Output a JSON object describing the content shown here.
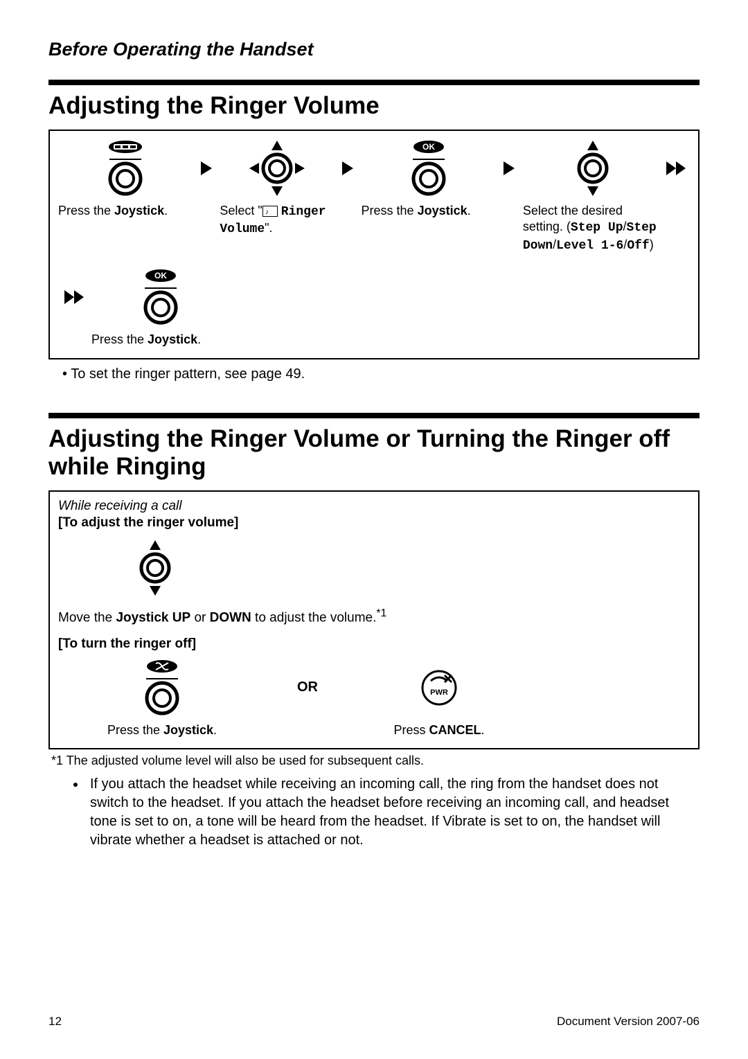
{
  "header": "Before Operating the Handset",
  "title1": "Adjusting the Ringer Volume",
  "steps1": {
    "s1": "Press the <b>Joystick</b>.",
    "s2": "Select \"<svg style='display:inline;vertical-align:-3px' width='22' height='16'><rect x='0.5' y='0.5' width='21' height='15' fill='none' stroke='#000'/><text x='4' y='12' font-size='10'>♪</text></svg> <span class='mono'>Ringer Volume</span>\".",
    "s3": "Press the <b>Joystick</b>.",
    "s4": "Select the desired setting. (<span class='mono'>Step Up</span>/<span class='mono'>Step Down</span>/<span class='mono'>Level 1-6</span>/<span class='mono'>Off</span>)",
    "s5": "Press the <b>Joystick</b>."
  },
  "bullet1": "To set the ringer pattern, see page 49.",
  "title2": "Adjusting the Ringer Volume or Turning the Ringer off while Ringing",
  "context2": "While receiving a call",
  "sub2a": "[To adjust the ringer volume]",
  "cap2a": "Move the <b>Joystick UP</b> or <b>DOWN</b> to adjust the volume.<sup>*1</sup>",
  "sub2b": "[To turn the ringer off]",
  "cap2b1": "Press the <b>Joystick</b>.",
  "or": "OR",
  "cap2b2": "Press <b>CANCEL</b>.",
  "footnote": "*1   The adjusted volume level will also be used for subsequent calls.",
  "bulletBody": "If you attach the headset while receiving an incoming call, the ring from the handset does not switch to the headset. If you attach the headset before receiving an incoming call, and headset tone is set to on, a tone will be heard from the headset. If Vibrate is set to on, the handset will vibrate whether a headset is attached or not.",
  "pageNum": "12",
  "docVer": "Document Version  2007-06"
}
